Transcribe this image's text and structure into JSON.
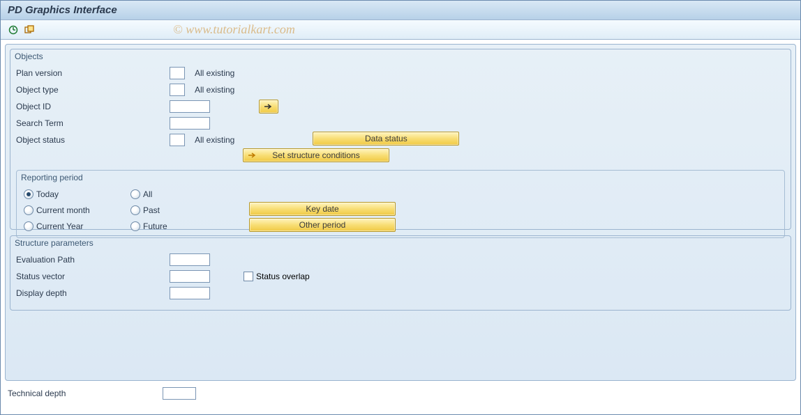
{
  "title": "PD Graphics Interface",
  "watermark": "© www.tutorialkart.com",
  "groups": {
    "objects": {
      "title": "Objects",
      "plan_version": {
        "label": "Plan version",
        "after": "All existing"
      },
      "object_type": {
        "label": "Object type",
        "after": "All existing"
      },
      "object_id": {
        "label": "Object ID"
      },
      "search_term": {
        "label": "Search Term"
      },
      "object_status": {
        "label": "Object status",
        "after": "All existing"
      },
      "btn_data_status": "Data status",
      "btn_set_struct": "Set structure conditions"
    },
    "reporting": {
      "title": "Reporting period",
      "radios": {
        "today": "Today",
        "all": "All",
        "current_month": "Current month",
        "past": "Past",
        "current_year": "Current Year",
        "future": "Future"
      },
      "btn_key_date": "Key date",
      "btn_other_period": "Other period"
    },
    "structure": {
      "title": "Structure parameters",
      "eval_path": "Evaluation Path",
      "status_vector": "Status vector",
      "status_overlap": "Status overlap",
      "display_depth": "Display depth"
    }
  },
  "technical_depth": "Technical depth"
}
